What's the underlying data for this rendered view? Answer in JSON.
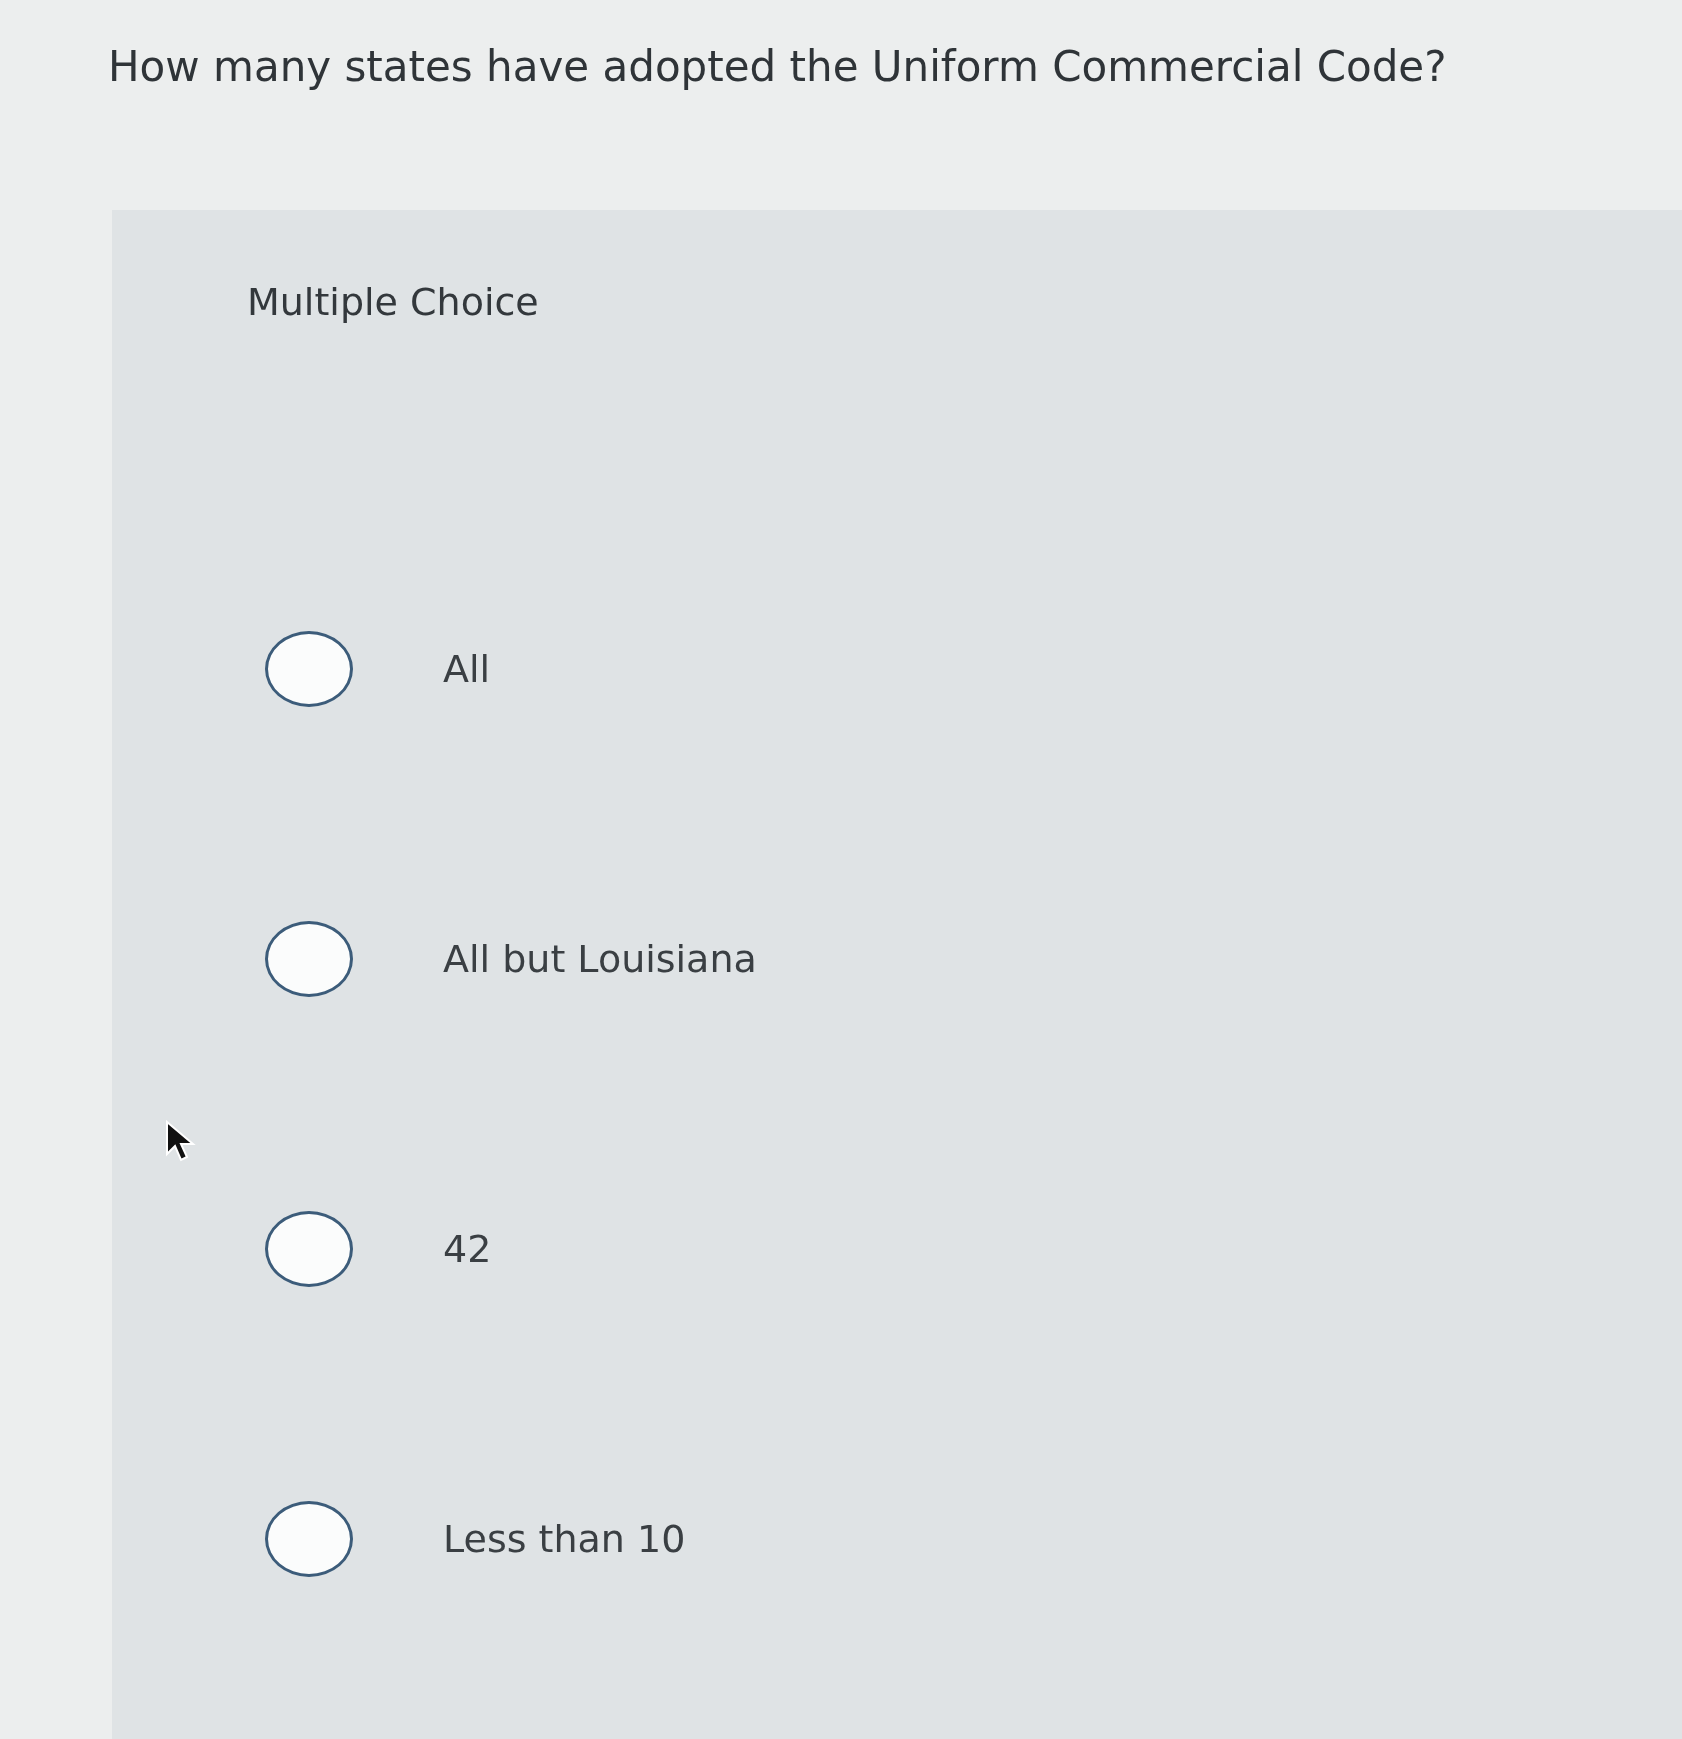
{
  "question": "How many states have adopted the Uniform Commercial Code?",
  "panel": {
    "type_label": "Multiple Choice",
    "options": [
      {
        "label": "All",
        "selected": false
      },
      {
        "label": "All but Louisiana",
        "selected": false
      },
      {
        "label": "42",
        "selected": false
      },
      {
        "label": "Less than 10",
        "selected": false
      }
    ]
  }
}
